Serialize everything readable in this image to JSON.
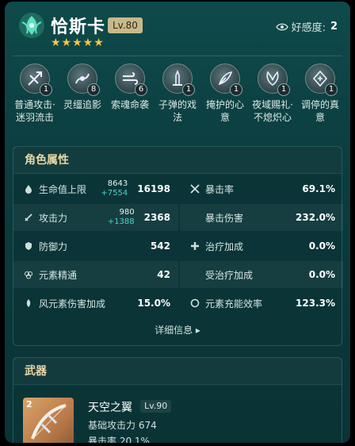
{
  "header": {
    "name": "恰斯卡",
    "level": "Lv.80",
    "stars": "★★★★★",
    "favor_label": "好感度:",
    "favor_value": "2"
  },
  "skills": [
    {
      "label": "普通攻击·迷羽流击",
      "level": "1",
      "icon": "crossbow-icon"
    },
    {
      "label": "灵缰追影",
      "level": "8",
      "icon": "ribbon-icon"
    },
    {
      "label": "索魂命袭",
      "level": "6",
      "icon": "wind-icon"
    },
    {
      "label": "子弹的戏法",
      "level": "1",
      "icon": "bullet-icon"
    },
    {
      "label": "掩护的心意",
      "level": "1",
      "icon": "feather-icon"
    },
    {
      "label": "夜域赐礼·不熄炽心",
      "level": "1",
      "icon": "wing-icon"
    },
    {
      "label": "调停的真意",
      "level": "1",
      "icon": "seal-icon"
    }
  ],
  "attributes": {
    "title": "角色属性",
    "hp": {
      "label": "生命值上限",
      "base": "8643",
      "bonus": "+7554",
      "value": "16198"
    },
    "atk": {
      "label": "攻击力",
      "base": "980",
      "bonus": "+1388",
      "value": "2368"
    },
    "def": {
      "label": "防御力",
      "value": "542"
    },
    "em": {
      "label": "元素精通",
      "value": "42"
    },
    "anemo": {
      "label": "风元素伤害加成",
      "value": "15.0%"
    },
    "crit_rate": {
      "label": "暴击率",
      "value": "69.1%"
    },
    "crit_dmg": {
      "label": "暴击伤害",
      "value": "232.0%"
    },
    "heal": {
      "label": "治疗加成",
      "value": "0.0%"
    },
    "inc_heal": {
      "label": "受治疗加成",
      "value": "0.0%"
    },
    "er": {
      "label": "元素充能效率",
      "value": "123.3%"
    },
    "detail_link": "详细信息 ▸"
  },
  "weapon": {
    "title": "武器",
    "refinement": "2",
    "name": "天空之翼",
    "level": "Lv.90",
    "base_atk": "基础攻击力 674",
    "substat": "暴击率 20.1%"
  }
}
